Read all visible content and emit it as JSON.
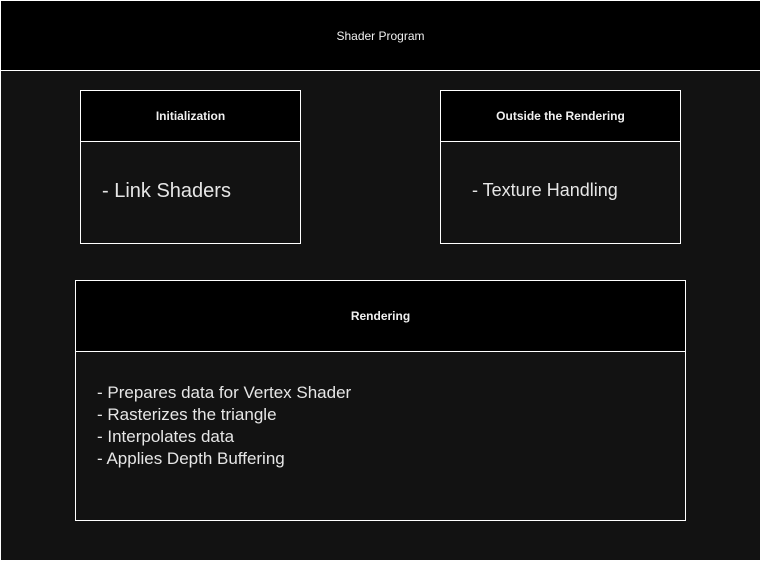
{
  "container": {
    "title": "Shader Program"
  },
  "boxes": {
    "initialization": {
      "title": "Initialization",
      "items": [
        "- Link Shaders"
      ]
    },
    "outside_rendering": {
      "title": "Outside the Rendering",
      "items": [
        "- Texture Handling"
      ]
    },
    "rendering": {
      "title": "Rendering",
      "items": [
        "- Prepares data for Vertex Shader",
        "- Rasterizes the triangle",
        "- Interpolates data",
        "- Applies Depth Buffering"
      ]
    }
  },
  "colors": {
    "background": "#121212",
    "header": "#000000",
    "border": "#ffffff",
    "text": "#f0f0f0"
  }
}
